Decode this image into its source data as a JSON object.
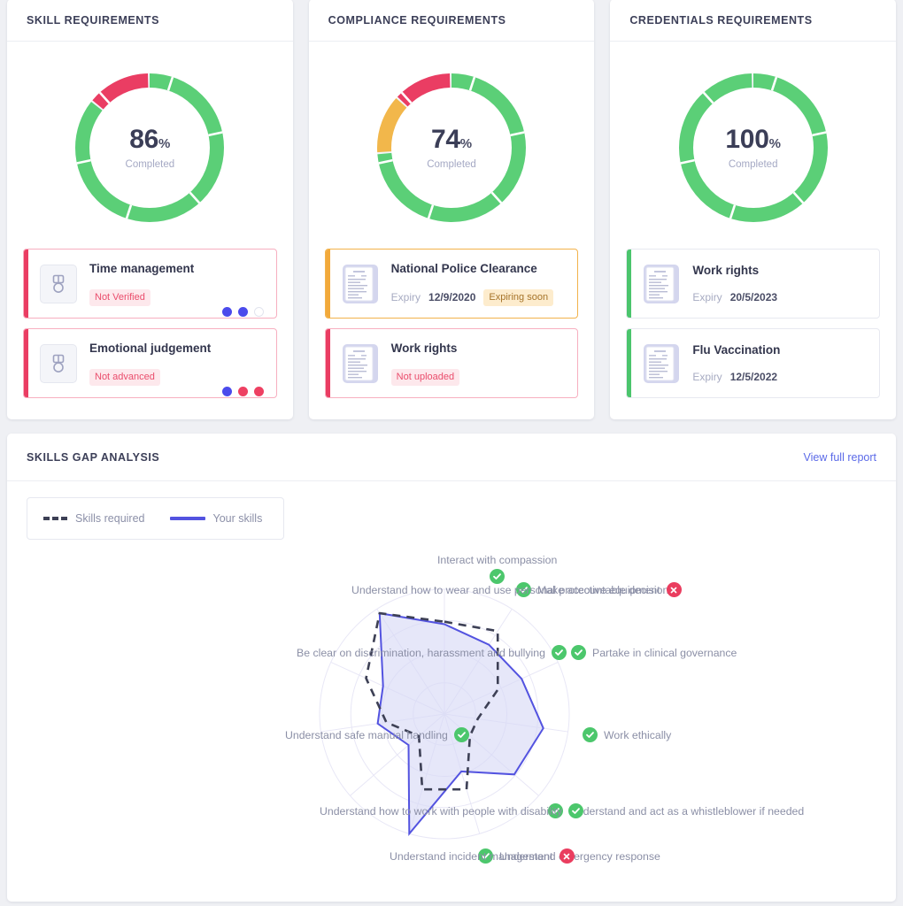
{
  "colors": {
    "green": "#5bcf77",
    "red": "#ea3d63",
    "amber": "#f2a93b",
    "blue": "#4b4bec",
    "indigo": "#5353e0",
    "link": "#5b6ae8",
    "page_bg": "#eff0f4"
  },
  "cards": [
    {
      "title": "SKILL REQUIREMENTS",
      "donut": {
        "value": "86",
        "percent_symbol": "%",
        "caption": "Completed",
        "segments": [
          {
            "name": "complete",
            "color": "#5bcf77",
            "portion": 86
          },
          {
            "name": "incomplete",
            "color": "#ea3d63",
            "portion": 14
          }
        ],
        "tick_count": 6
      },
      "items": [
        {
          "title": "Time management",
          "icon": "medal-icon",
          "status": "danger",
          "badge": {
            "text": "Not Verified",
            "style": "pink"
          },
          "dots": [
            "blue",
            "blue",
            "empty"
          ]
        },
        {
          "title": "Emotional judgement",
          "icon": "medal-icon",
          "status": "danger",
          "badge": {
            "text": "Not advanced",
            "style": "pink"
          },
          "dots": [
            "blue",
            "red",
            "red"
          ]
        }
      ]
    },
    {
      "title": "COMPLIANCE REQUIREMENTS",
      "donut": {
        "value": "74",
        "percent_symbol": "%",
        "caption": "Completed",
        "segments": [
          {
            "name": "complete",
            "color": "#5bcf77",
            "portion": 74
          },
          {
            "name": "expiring",
            "color": "#f2b74b",
            "portion": 13
          },
          {
            "name": "missing",
            "color": "#ea3d63",
            "portion": 13
          }
        ],
        "tick_count": 6
      },
      "items": [
        {
          "title": "National Police Clearance",
          "icon": "document-icon",
          "status": "warning",
          "expiry_label": "Expiry",
          "expiry_value": "12/9/2020",
          "badge": {
            "text": "Expiring soon",
            "style": "amber"
          }
        },
        {
          "title": "Work rights",
          "icon": "document-icon",
          "status": "danger",
          "badge": {
            "text": "Not uploaded",
            "style": "pink"
          }
        }
      ]
    },
    {
      "title": "CREDENTIALS REQUIREMENTS",
      "donut": {
        "value": "100",
        "percent_symbol": "%",
        "caption": "Completed",
        "segments": [
          {
            "name": "complete",
            "color": "#5bcf77",
            "portion": 100
          }
        ],
        "tick_count": 6
      },
      "items": [
        {
          "title": "Work rights",
          "icon": "document-icon",
          "status": "ok",
          "expiry_label": "Expiry",
          "expiry_value": "20/5/2023"
        },
        {
          "title": "Flu Vaccination",
          "icon": "document-icon",
          "status": "ok",
          "expiry_label": "Expiry",
          "expiry_value": "12/5/2022"
        }
      ]
    }
  ],
  "skills_gap": {
    "title": "SKILLS GAP ANALYSIS",
    "view_report_label": "View full report",
    "legend": [
      {
        "label": "Skills required",
        "style": "dashed",
        "color": "#3d4055"
      },
      {
        "label": "Your skills",
        "style": "solid",
        "color": "#5353e0"
      }
    ]
  },
  "chart_data": {
    "type": "radar",
    "title": "SKILLS GAP ANALYSIS",
    "center": [
      502,
      823
    ],
    "max_radius": 141,
    "rings": 4,
    "grid": true,
    "legend_position": "top-left",
    "value_range": [
      0,
      100
    ],
    "categories": [
      "Interact with compassion",
      "Make accountable decisions",
      "Partake in clinical governance",
      "Work ethically",
      "Understand and act as a whistleblower if needed",
      "Understand emergency response",
      "Understand incident management",
      "Understand how to work with people with disability",
      "Understand safe manual handling",
      "Be clear on discrimination, harassment and bullying",
      "Understand how to wear and use personal protective equipment"
    ],
    "statuses": [
      "ok",
      "ok",
      "ok",
      "ok",
      "ok",
      "ok",
      "bad",
      "ok",
      "ok",
      "ok",
      "bad"
    ],
    "series": [
      {
        "name": "Skills required",
        "style": "dashed",
        "color": "#3d4055",
        "values": [
          74,
          79,
          47,
          27,
          27,
          63,
          63,
          27,
          47,
          69,
          96
        ]
      },
      {
        "name": "Your skills",
        "style": "solid",
        "color": "#5353e0",
        "fill": "#d7d8f6",
        "values": [
          72,
          66,
          68,
          80,
          74,
          48,
          100,
          38,
          54,
          54,
          96
        ]
      }
    ]
  }
}
